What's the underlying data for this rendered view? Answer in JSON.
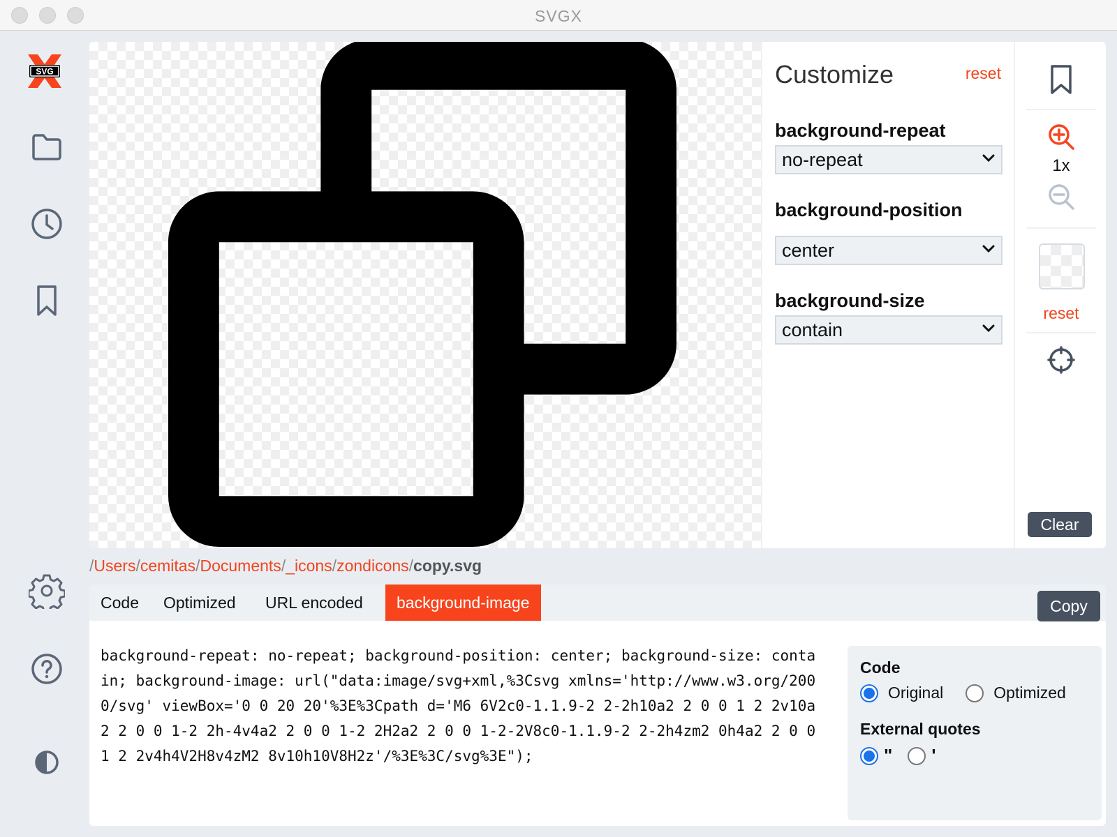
{
  "window": {
    "title": "SVGX"
  },
  "app": {
    "logo_text": "SVG"
  },
  "sidebar": {
    "items": [
      {
        "name": "folder",
        "icon": "folder-icon"
      },
      {
        "name": "history",
        "icon": "clock-icon"
      },
      {
        "name": "bookmarks",
        "icon": "bookmark-icon"
      },
      {
        "name": "settings",
        "icon": "gear-icon"
      },
      {
        "name": "help",
        "icon": "question-icon"
      },
      {
        "name": "theme",
        "icon": "contrast-icon"
      }
    ]
  },
  "customize": {
    "title": "Customize",
    "reset_label": "reset",
    "properties": [
      {
        "label": "background-repeat",
        "value": "no-repeat"
      },
      {
        "label": "background-position",
        "value": "center"
      },
      {
        "label": "background-size",
        "value": "contain"
      }
    ]
  },
  "tools": {
    "zoom_label": "1x",
    "bg_reset_label": "reset",
    "clear_label": "Clear"
  },
  "breadcrumb": {
    "segments": [
      "Users",
      "cemitas",
      "Documents",
      "_icons",
      "zondicons"
    ],
    "file": "copy.svg",
    "separator": "/"
  },
  "code_panel": {
    "tabs": [
      "Code",
      "Optimized",
      "URL encoded",
      "background-image"
    ],
    "active_tab": "background-image",
    "copy_label": "Copy",
    "code": "background-repeat: no-repeat; background-position: center; background-size: contain; background-image: url(\"data:image/svg+xml,%3Csvg xmlns='http://www.w3.org/2000/svg' viewBox='0 0 20 20'%3E%3Cpath d='M6 6V2c0-1.1.9-2 2-2h10a2 2 0 0 1 2 2v10a2 2 0 0 1-2 2h-4v4a2 2 0 0 1-2 2H2a2 2 0 0 1-2-2V8c0-1.1.9-2 2-2h4zm2 0h4a2 2 0 0 1 2 2v4h4V2H8v4zM2 8v10h10V8H2z'/%3E%3C/svg%3E\");",
    "options": {
      "code_heading": "Code",
      "code_options": [
        "Original",
        "Optimized"
      ],
      "code_selected": "Original",
      "quotes_heading": "External quotes",
      "quote_options": [
        "\"",
        "'"
      ],
      "quote_selected": "\""
    }
  },
  "colors": {
    "accent": "#f7441c",
    "dark_button": "#475160",
    "radio": "#1a73e8"
  }
}
